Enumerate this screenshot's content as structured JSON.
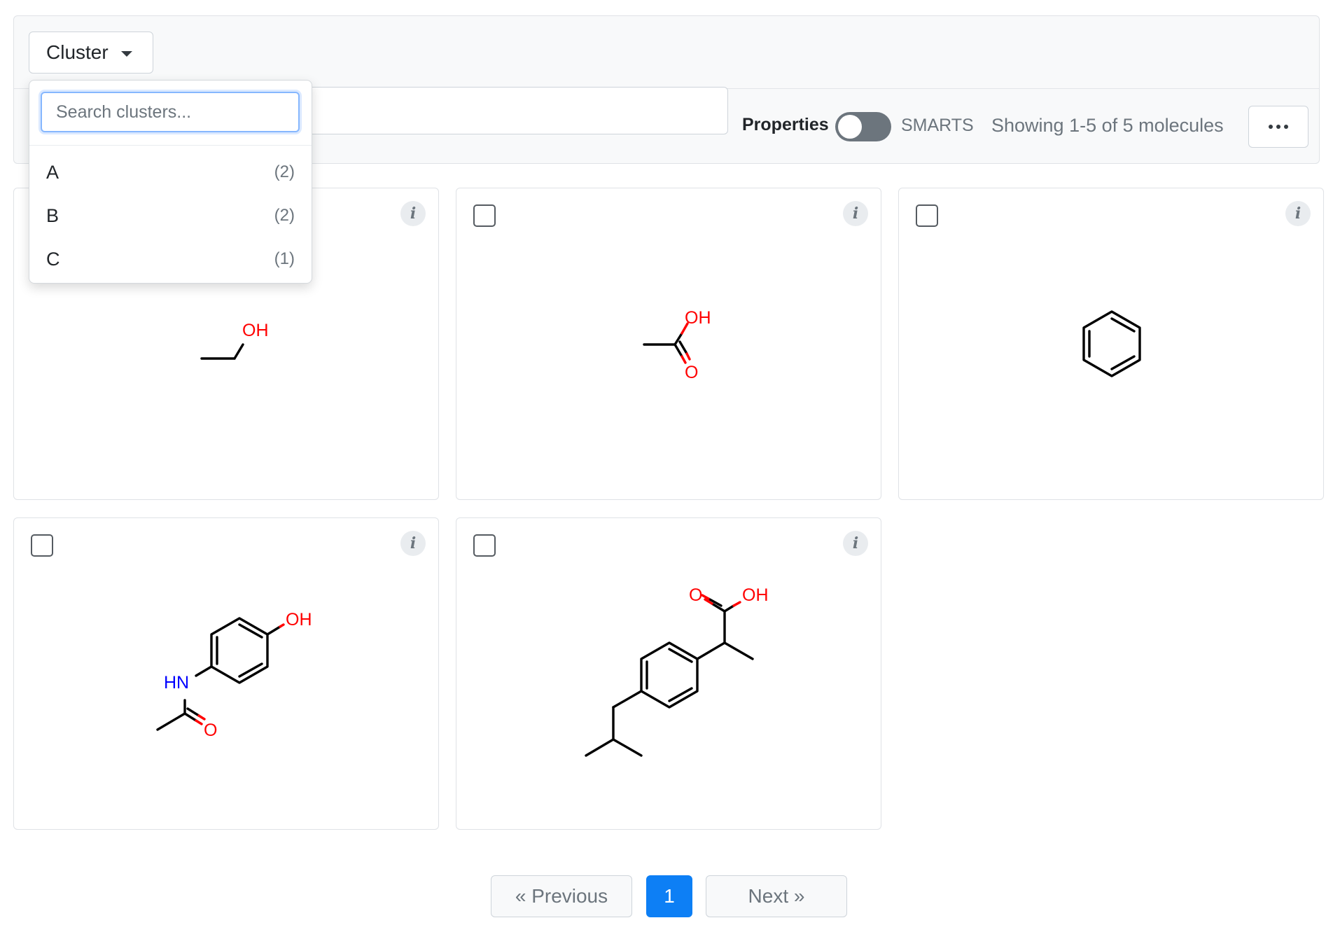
{
  "toolbar": {
    "cluster_label": "Cluster",
    "properties_label": "Properties",
    "smarts_label": "SMARTS",
    "showing": "Showing 1-5 of 5 molecules",
    "smarts_toggle_on": false
  },
  "cluster_dropdown": {
    "search_placeholder": "Search clusters...",
    "items": [
      {
        "label": "A",
        "count": "(2)"
      },
      {
        "label": "B",
        "count": "(2)"
      },
      {
        "label": "C",
        "count": "(1)"
      }
    ]
  },
  "molecules": [
    {
      "atoms": [
        "OH"
      ],
      "checked": false
    },
    {
      "atoms": [
        "OH",
        "O"
      ],
      "checked": false
    },
    {
      "atoms": [],
      "checked": false
    },
    {
      "atoms": [
        "OH",
        "HN",
        "O"
      ],
      "checked": false
    },
    {
      "atoms": [
        "O",
        "OH"
      ],
      "checked": false
    }
  ],
  "card": {
    "info_label": "i"
  },
  "pagination": {
    "previous": "« Previous",
    "current": "1",
    "next": "Next »"
  },
  "colors": {
    "accent": "#0d7ff5",
    "oxygen": "#ff0000",
    "nitrogen": "#0000ff",
    "bond": "#000000",
    "toggle_off": "#6c757d"
  }
}
